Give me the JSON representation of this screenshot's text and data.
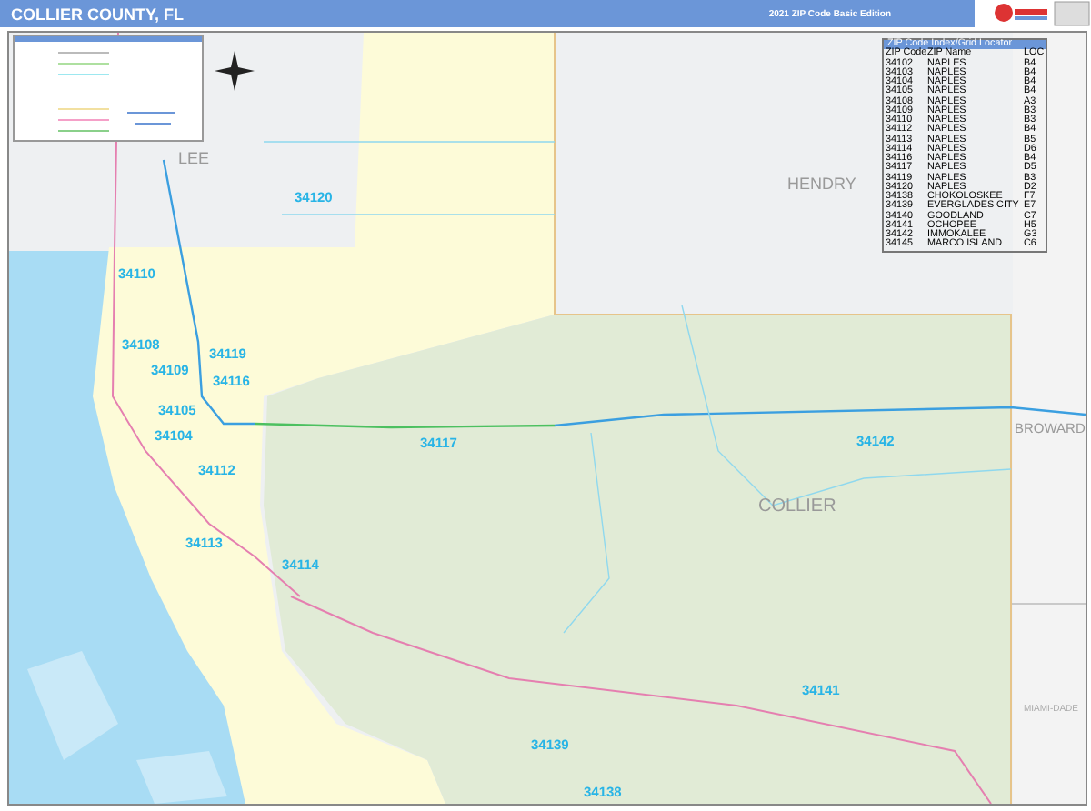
{
  "header": {
    "title": "COLLIER COUNTY, FL",
    "edition": "2021 ZIP Code Basic Edition"
  },
  "map": {
    "county_labels": [
      {
        "text": "LEE",
        "kind": "neighbor"
      },
      {
        "text": "HENDRY",
        "kind": "neighbor"
      },
      {
        "text": "COLLIER",
        "kind": "main"
      },
      {
        "text": "BROWARD",
        "kind": "neighbor"
      },
      {
        "text": "MIAMI-DADE",
        "kind": "small"
      }
    ],
    "zip_labels": [
      "34120",
      "34110",
      "34108",
      "34119",
      "34109",
      "34116",
      "34105",
      "34104",
      "34117",
      "34112",
      "34113",
      "34114",
      "34142",
      "34141",
      "34139",
      "34138"
    ]
  },
  "zip_index": {
    "title": "ZIP Code Index/Grid Locator",
    "columns": [
      "ZIP Code",
      "ZIP Name",
      "LOC"
    ],
    "rows": [
      [
        "34102",
        "NAPLES",
        "B4"
      ],
      [
        "34103",
        "NAPLES",
        "B4"
      ],
      [
        "34104",
        "NAPLES",
        "B4"
      ],
      [
        "34105",
        "NAPLES",
        "B4"
      ],
      [
        "34108",
        "NAPLES",
        "A3"
      ],
      [
        "34109",
        "NAPLES",
        "B3"
      ],
      [
        "34110",
        "NAPLES",
        "B3"
      ],
      [
        "34112",
        "NAPLES",
        "B4"
      ],
      [
        "34113",
        "NAPLES",
        "B5"
      ],
      [
        "34114",
        "NAPLES",
        "D6"
      ],
      [
        "34116",
        "NAPLES",
        "B4"
      ],
      [
        "34117",
        "NAPLES",
        "D5"
      ],
      [
        "34119",
        "NAPLES",
        "B3"
      ],
      [
        "34120",
        "NAPLES",
        "D2"
      ],
      [
        "34138",
        "CHOKOLOSKEE",
        "F7"
      ],
      [
        "34139",
        "EVERGLADES CITY",
        "E7"
      ],
      [
        "34140",
        "GOODLAND",
        "C7"
      ],
      [
        "34141",
        "OCHOPEE",
        "H5"
      ],
      [
        "34142",
        "IMMOKALEE",
        "G3"
      ],
      [
        "34145",
        "MARCO ISLAND",
        "C6"
      ]
    ]
  }
}
